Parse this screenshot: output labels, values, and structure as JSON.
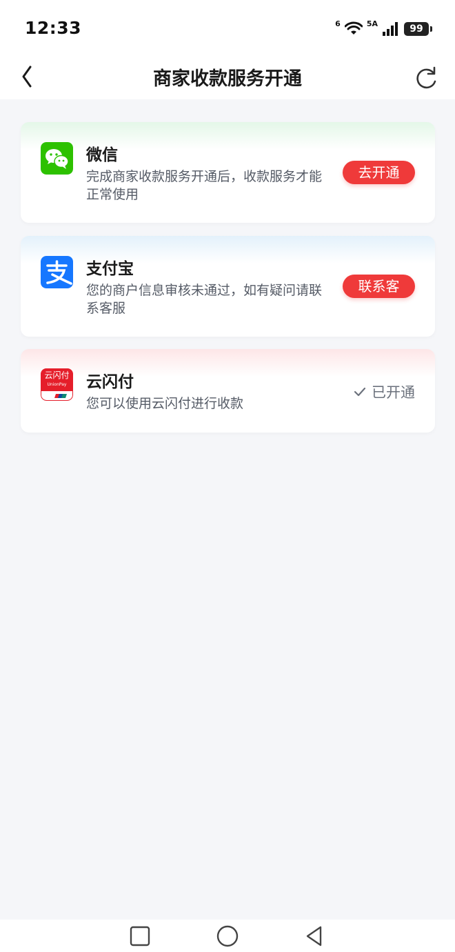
{
  "status_bar": {
    "time": "12:33",
    "network_primary": "6",
    "network_secondary": "5A",
    "battery": "99"
  },
  "header": {
    "title": "商家收款服务开通",
    "back_icon": "chevron-left-icon",
    "refresh_icon": "refresh-icon"
  },
  "services": [
    {
      "name": "微信",
      "description": "完成商家收款服务开通后，收款服务才能正常使用",
      "action_label": "去开通",
      "logo": "wechat-logo",
      "accent": "#1aad19"
    },
    {
      "name": "支付宝",
      "description": "您的商户信息审核未通过，如有疑问请联系客服",
      "action_label": "联系客服",
      "logo": "alipay-logo",
      "accent": "#1677ff"
    },
    {
      "name": "云闪付",
      "description": "您可以使用云闪付进行收款",
      "status_label": "已开通",
      "logo": "unionpay-logo",
      "logo_text": "云闪付",
      "logo_subtext": "UnionPay",
      "accent": "#e51e2a"
    }
  ],
  "colors": {
    "action_red": "#ef3a3a",
    "background": "#f5f6f9"
  }
}
